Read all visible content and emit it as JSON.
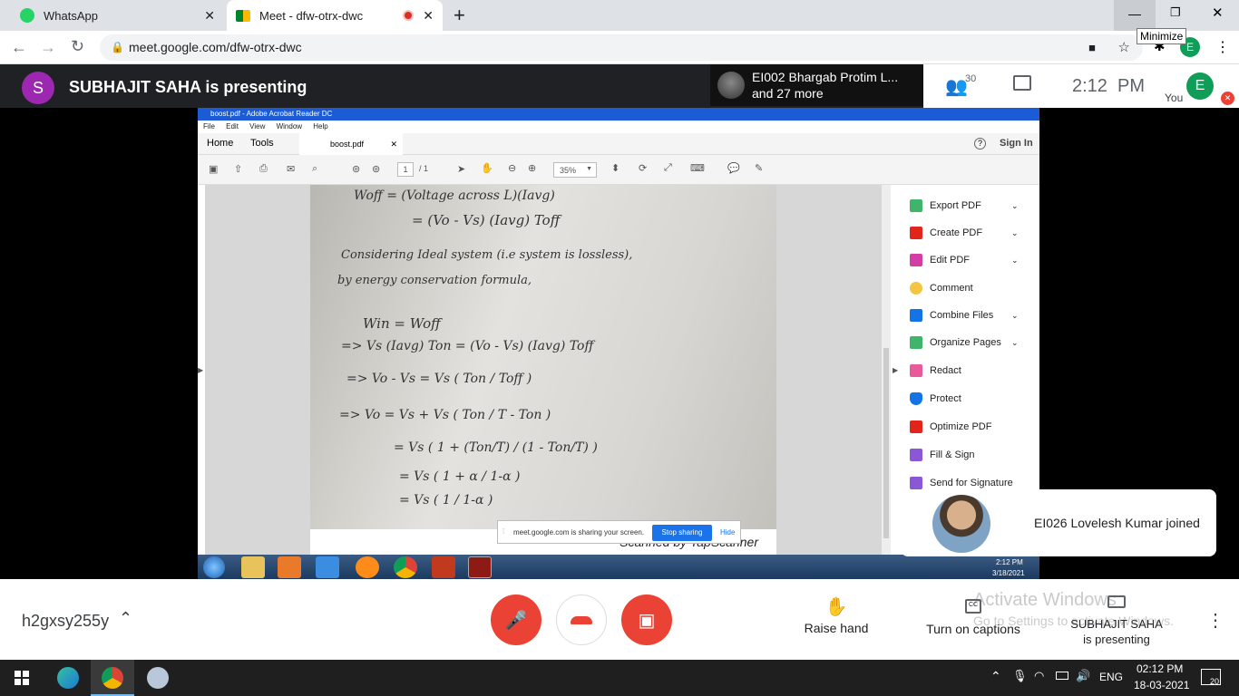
{
  "browser": {
    "tabs": [
      {
        "label": "WhatsApp"
      },
      {
        "label": "Meet - dfw-otrx-dwc"
      }
    ],
    "url": "meet.google.com/dfw-otrx-dwc",
    "tooltip": "Minimize",
    "profile_initial": "E"
  },
  "meet": {
    "presenter_initial": "S",
    "presenter_text": "SUBHAJIT SAHA is presenting",
    "participants_card": {
      "line1": "EI002 Bhargab Protim L...",
      "line2": "and 27 more"
    },
    "participant_count": "30",
    "time": "2:12  PM",
    "you_label": "You",
    "you_initial": "E",
    "toast": "EI026 Lovelesh Kumar joined",
    "meeting_code": "h2gxsy255y",
    "raise_hand": "Raise hand",
    "captions": "Turn on captions",
    "presenting_line1": "SUBHAJIT SAHA",
    "presenting_line2": "is presenting",
    "watermark_line1": "Activate Windows",
    "watermark_line2": "Go to Settings to activate Windows."
  },
  "acrobat": {
    "title": "boost.pdf - Adobe Acrobat Reader DC",
    "menu": [
      "File",
      "Edit",
      "View",
      "Window",
      "Help"
    ],
    "home": "Home",
    "tools": "Tools",
    "doc_tab": "boost.pdf",
    "sign_in": "Sign In",
    "page_num": "1",
    "page_total": "/ 1",
    "zoom": "35%",
    "panel": [
      "Export PDF",
      "Create PDF",
      "Edit PDF",
      "Comment",
      "Combine Files",
      "Organize Pages",
      "Redact",
      "Protect",
      "Optimize PDF",
      "Fill & Sign",
      "Send for Signature"
    ],
    "share_notice": "meet.google.com is sharing your screen.",
    "stop_sharing": "Stop sharing",
    "hide": "Hide",
    "footer_text": "Scanned by TapScanner",
    "win7_time": "2:12 PM",
    "win7_date": "3/18/2021"
  },
  "handwriting": [
    "Woff = (Voltage across L)(Iavg)",
    "= (Vo - Vs) (Iavg) Toff",
    "Considering Ideal system (i.e system is lossless),",
    "by energy conservation formula,",
    "Win = Woff",
    "=> Vs (Iavg) Ton = (Vo - Vs) (Iavg) Toff",
    "=> Vo - Vs = Vs ( Ton / Toff )",
    "=> Vo = Vs + Vs ( Ton / T - Ton )",
    "= Vs ( 1 + (Ton/T) / (1 - Ton/T) )",
    "= Vs ( 1 + α / 1-α )",
    "= Vs ( 1 / 1-α )"
  ],
  "windows": {
    "time": "02:12 PM",
    "date": "18-03-2021",
    "lang": "ENG",
    "notif": "20"
  }
}
